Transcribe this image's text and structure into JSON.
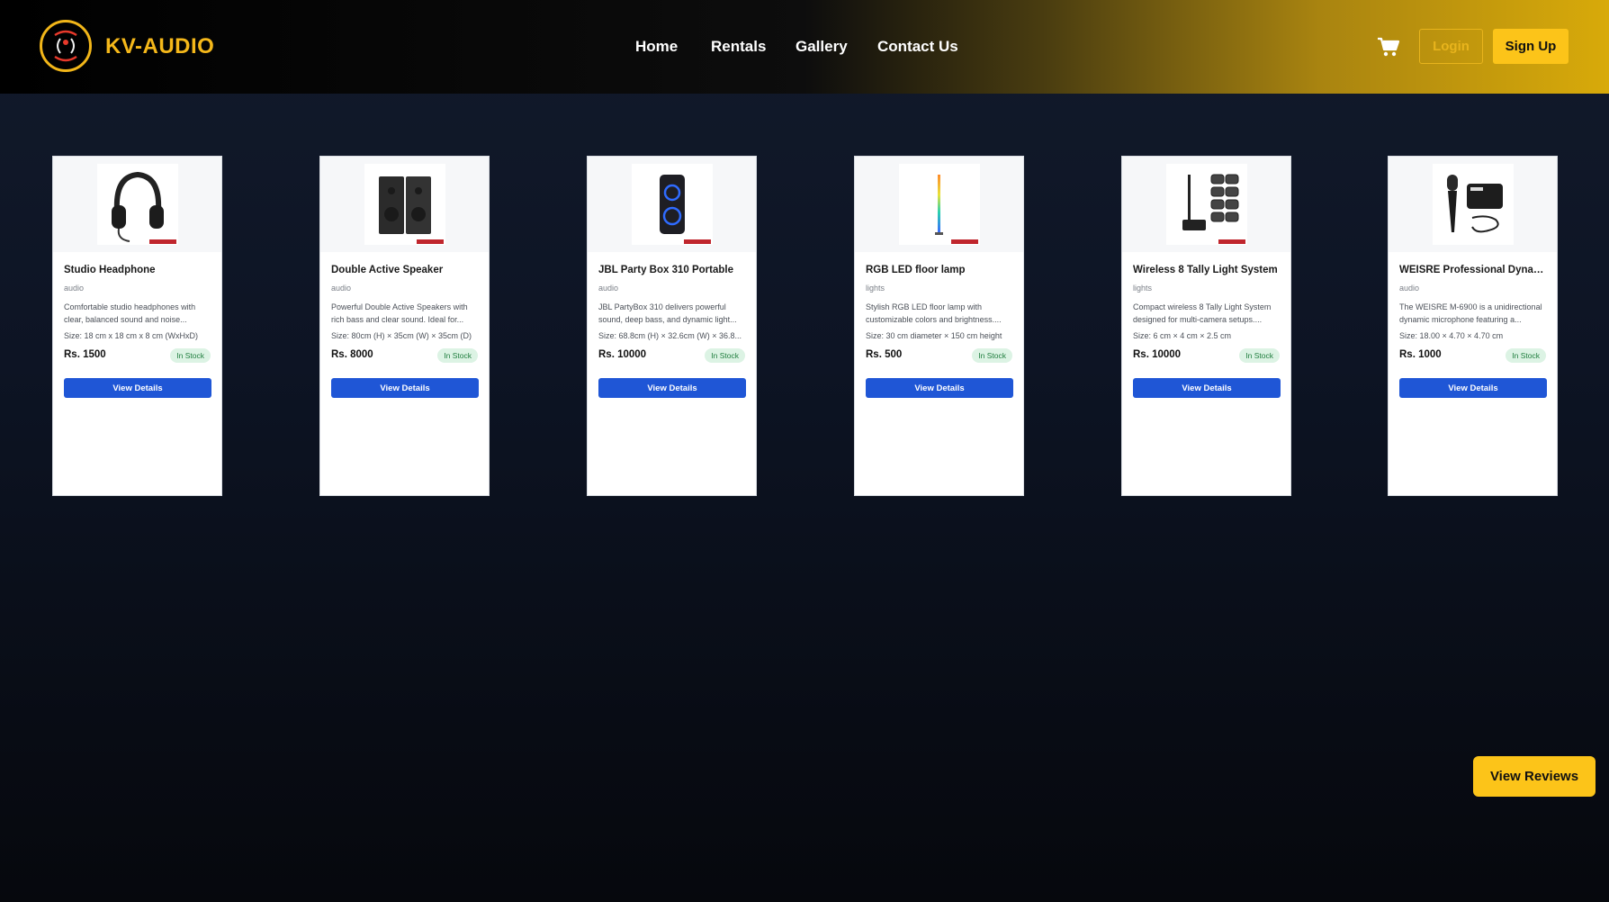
{
  "header": {
    "brand": "KV-AUDIO",
    "nav": [
      {
        "label": "Home"
      },
      {
        "label": "Rentals"
      },
      {
        "label": "Gallery"
      },
      {
        "label": "Contact Us"
      }
    ],
    "cart_icon": "cart-icon",
    "login_label": "Login",
    "signup_label": "Sign Up"
  },
  "products": [
    {
      "title": "Studio Headphone",
      "category": "audio",
      "description": "Comfortable studio headphones with clear, balanced sound and noise...",
      "size": "Size: 18 cm x 18 cm x 8 cm (WxHxD)",
      "price": "Rs. 1500",
      "stock": "In Stock",
      "button": "View Details",
      "icon": "headphone-image"
    },
    {
      "title": "Double Active Speaker",
      "category": "audio",
      "description": "Powerful Double Active Speakers with rich bass and clear sound. Ideal for...",
      "size": "Size: 80cm (H) × 35cm (W) × 35cm (D)",
      "price": "Rs. 8000",
      "stock": "In Stock",
      "button": "View Details",
      "icon": "speaker-image"
    },
    {
      "title": "JBL Party Box 310 Portable",
      "category": "audio",
      "description": "JBL PartyBox 310 delivers powerful sound, deep bass, and dynamic light...",
      "size": "Size: 68.8cm (H) × 32.6cm (W) × 36.8...",
      "price": "Rs. 10000",
      "stock": "In Stock",
      "button": "View Details",
      "icon": "partybox-image"
    },
    {
      "title": "RGB LED floor lamp",
      "category": "lights",
      "description": "Stylish RGB LED floor lamp with customizable colors and brightness....",
      "size": "Size: 30 cm diameter × 150 cm height",
      "price": "Rs. 500",
      "stock": "In Stock",
      "button": "View Details",
      "icon": "floor-lamp-image"
    },
    {
      "title": "Wireless 8 Tally Light System",
      "category": "lights",
      "description": "Compact wireless 8 Tally Light System designed for multi-camera setups....",
      "size": "Size: 6 cm × 4 cm × 2.5 cm",
      "price": "Rs. 10000",
      "stock": "In Stock",
      "button": "View Details",
      "icon": "tally-light-image"
    },
    {
      "title": "WEISRE Professional Dynamic...",
      "category": "audio",
      "description": "The WEISRE M-6900 is a unidirectional dynamic microphone featuring a...",
      "size": "Size: 18.00 × 4.70 × 4.70 cm",
      "price": "Rs. 1000",
      "stock": "In Stock",
      "button": "View Details",
      "icon": "microphone-image"
    }
  ],
  "reviews_label": "View Reviews",
  "colors": {
    "accent": "#fcc419",
    "button_blue": "#1f56d6",
    "stock_green": "#1e7d3d"
  }
}
